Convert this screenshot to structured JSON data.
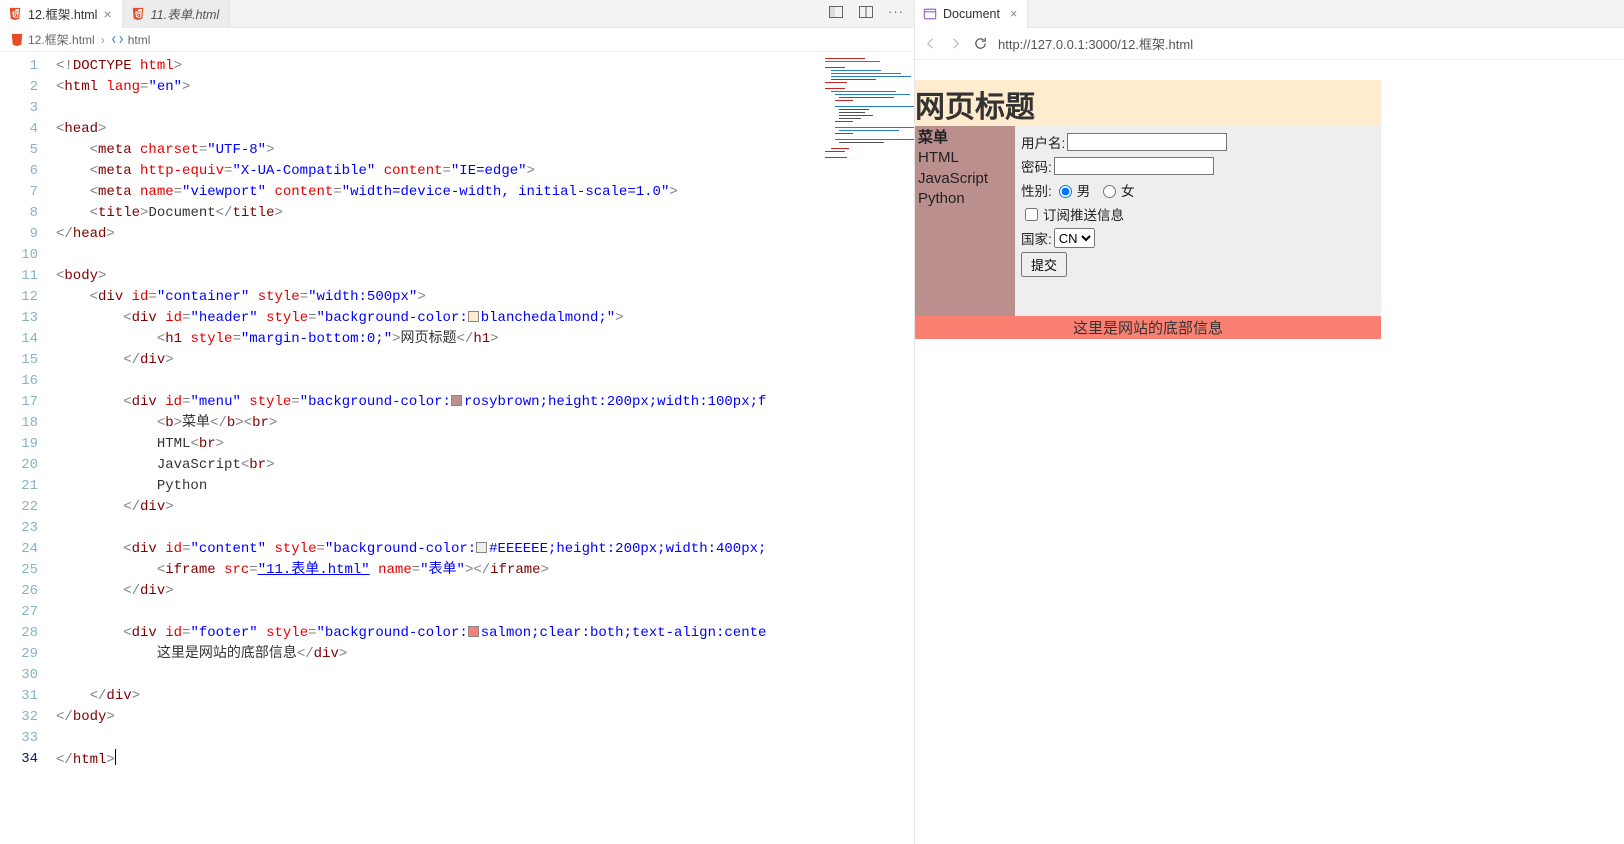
{
  "tabs": {
    "active": {
      "label": "12.框架.html"
    },
    "inactive": {
      "label": "11.表单.html"
    }
  },
  "breadcrumb": {
    "file": "12.框架.html",
    "node": "html"
  },
  "code": [
    {
      "n": "1",
      "html": "<span class='c-gray'>&lt;!</span><span class='c-tag'>DOCTYPE</span> <span class='c-attr'>html</span><span class='c-gray'>&gt;</span>"
    },
    {
      "n": "2",
      "html": "<span class='c-gray'>&lt;</span><span class='c-tag'>html</span> <span class='c-attr'>lang</span><span class='c-gray'>=</span><span class='c-str'>\"en\"</span><span class='c-gray'>&gt;</span>"
    },
    {
      "n": "3",
      "html": ""
    },
    {
      "n": "4",
      "html": "<span class='c-gray'>&lt;</span><span class='c-tag'>head</span><span class='c-gray'>&gt;</span>"
    },
    {
      "n": "5",
      "html": "    <span class='c-gray'>&lt;</span><span class='c-tag'>meta</span> <span class='c-attr'>charset</span><span class='c-gray'>=</span><span class='c-str'>\"UTF-8\"</span><span class='c-gray'>&gt;</span>"
    },
    {
      "n": "6",
      "html": "    <span class='c-gray'>&lt;</span><span class='c-tag'>meta</span> <span class='c-attr'>http-equiv</span><span class='c-gray'>=</span><span class='c-str'>\"X-UA-Compatible\"</span> <span class='c-attr'>content</span><span class='c-gray'>=</span><span class='c-str'>\"IE=edge\"</span><span class='c-gray'>&gt;</span>"
    },
    {
      "n": "7",
      "html": "    <span class='c-gray'>&lt;</span><span class='c-tag'>meta</span> <span class='c-attr'>name</span><span class='c-gray'>=</span><span class='c-str'>\"viewport\"</span> <span class='c-attr'>content</span><span class='c-gray'>=</span><span class='c-str'>\"width=device-width, initial-scale=1.0\"</span><span class='c-gray'>&gt;</span>"
    },
    {
      "n": "8",
      "html": "    <span class='c-gray'>&lt;</span><span class='c-tag'>title</span><span class='c-gray'>&gt;</span><span class='c-text'>Document</span><span class='c-gray'>&lt;/</span><span class='c-tag'>title</span><span class='c-gray'>&gt;</span>"
    },
    {
      "n": "9",
      "html": "<span class='c-gray'>&lt;/</span><span class='c-tag'>head</span><span class='c-gray'>&gt;</span>"
    },
    {
      "n": "10",
      "html": ""
    },
    {
      "n": "11",
      "html": "<span class='c-gray'>&lt;</span><span class='c-tag'>body</span><span class='c-gray'>&gt;</span>"
    },
    {
      "n": "12",
      "html": "    <span class='c-gray'>&lt;</span><span class='c-tag'>div</span> <span class='c-attr'>id</span><span class='c-gray'>=</span><span class='c-str'>\"container\"</span> <span class='c-attr'>style</span><span class='c-gray'>=</span><span class='c-str'>\"width:500px\"</span><span class='c-gray'>&gt;</span>"
    },
    {
      "n": "13",
      "html": "        <span class='c-gray'>&lt;</span><span class='c-tag'>div</span> <span class='c-attr'>id</span><span class='c-gray'>=</span><span class='c-str'>\"header\"</span> <span class='c-attr'>style</span><span class='c-gray'>=</span><span class='c-str'>\"background-color:<span class='css-swatch' style='background:blanchedalmond'></span>blanchedalmond;\"</span><span class='c-gray'>&gt;</span>"
    },
    {
      "n": "14",
      "html": "            <span class='c-gray'>&lt;</span><span class='c-tag'>h1</span> <span class='c-attr'>style</span><span class='c-gray'>=</span><span class='c-str'>\"margin-bottom:0;\"</span><span class='c-gray'>&gt;</span><span class='c-text'>网页标题</span><span class='c-gray'>&lt;/</span><span class='c-tag'>h1</span><span class='c-gray'>&gt;</span>"
    },
    {
      "n": "15",
      "html": "        <span class='c-gray'>&lt;/</span><span class='c-tag'>div</span><span class='c-gray'>&gt;</span>"
    },
    {
      "n": "16",
      "html": ""
    },
    {
      "n": "17",
      "html": "        <span class='c-gray'>&lt;</span><span class='c-tag'>div</span> <span class='c-attr'>id</span><span class='c-gray'>=</span><span class='c-str'>\"menu\"</span> <span class='c-attr'>style</span><span class='c-gray'>=</span><span class='c-str'>\"background-color:<span class='css-swatch' style='background:rosybrown'></span>rosybrown;height:200px;width:100px;f</span>"
    },
    {
      "n": "18",
      "html": "            <span class='c-gray'>&lt;</span><span class='c-tag'>b</span><span class='c-gray'>&gt;</span><span class='c-text'>菜单</span><span class='c-gray'>&lt;/</span><span class='c-tag'>b</span><span class='c-gray'>&gt;&lt;</span><span class='c-tag'>br</span><span class='c-gray'>&gt;</span>"
    },
    {
      "n": "19",
      "html": "            <span class='c-text'>HTML</span><span class='c-gray'>&lt;</span><span class='c-tag'>br</span><span class='c-gray'>&gt;</span>"
    },
    {
      "n": "20",
      "html": "            <span class='c-text'>JavaScript</span><span class='c-gray'>&lt;</span><span class='c-tag'>br</span><span class='c-gray'>&gt;</span>"
    },
    {
      "n": "21",
      "html": "            <span class='c-text'>Python</span>"
    },
    {
      "n": "22",
      "html": "        <span class='c-gray'>&lt;/</span><span class='c-tag'>div</span><span class='c-gray'>&gt;</span>"
    },
    {
      "n": "23",
      "html": ""
    },
    {
      "n": "24",
      "html": "        <span class='c-gray'>&lt;</span><span class='c-tag'>div</span> <span class='c-attr'>id</span><span class='c-gray'>=</span><span class='c-str'>\"content\"</span> <span class='c-attr'>style</span><span class='c-gray'>=</span><span class='c-str'>\"background-color:<span class='css-swatch' style='background:#EEEEEE'></span>#EEEEEE;height:200px;width:400px;</span>"
    },
    {
      "n": "25",
      "html": "            <span class='c-gray'>&lt;</span><span class='c-tag'>iframe</span> <span class='c-attr'>src</span><span class='c-gray'>=</span><span class='c-link'>\"11.表单.html\"</span> <span class='c-attr'>name</span><span class='c-gray'>=</span><span class='c-str'>\"表单\"</span><span class='c-gray'>&gt;&lt;/</span><span class='c-tag'>iframe</span><span class='c-gray'>&gt;</span>"
    },
    {
      "n": "26",
      "html": "        <span class='c-gray'>&lt;/</span><span class='c-tag'>div</span><span class='c-gray'>&gt;</span>"
    },
    {
      "n": "27",
      "html": ""
    },
    {
      "n": "28",
      "html": "        <span class='c-gray'>&lt;</span><span class='c-tag'>div</span> <span class='c-attr'>id</span><span class='c-gray'>=</span><span class='c-str'>\"footer\"</span> <span class='c-attr'>style</span><span class='c-gray'>=</span><span class='c-str'>\"background-color:<span class='css-swatch' style='background:salmon'></span>salmon;clear:both;text-align:cente</span>"
    },
    {
      "n": "29",
      "html": "            <span class='c-text'>这里是网站的底部信息</span><span class='c-gray'>&lt;/</span><span class='c-tag'>div</span><span class='c-gray'>&gt;</span>"
    },
    {
      "n": "30",
      "html": ""
    },
    {
      "n": "31",
      "html": "    <span class='c-gray'>&lt;/</span><span class='c-tag'>div</span><span class='c-gray'>&gt;</span>"
    },
    {
      "n": "32",
      "html": "<span class='c-gray'>&lt;/</span><span class='c-tag'>body</span><span class='c-gray'>&gt;</span>"
    },
    {
      "n": "33",
      "html": ""
    },
    {
      "n": "34",
      "html": "<span class='c-gray'>&lt;/</span><span class='c-tag'>html</span><span class='c-gray'>&gt;</span><span class='cursor'></span>",
      "active": true
    }
  ],
  "preview": {
    "tab": "Document",
    "url": "http://127.0.0.1:3000/12.框架.html",
    "page": {
      "title": "网页标题",
      "menu_heading": "菜单",
      "menu_items": [
        "HTML",
        "JavaScript",
        "Python"
      ],
      "form": {
        "username_label": "用户名:",
        "password_label": "密码:",
        "gender_label": "性别:",
        "gender_male": "男",
        "gender_female": "女",
        "subscribe_label": "订阅推送信息",
        "country_label": "国家:",
        "country_value": "CN",
        "submit_label": "提交"
      },
      "footer": "这里是网站的底部信息"
    }
  }
}
